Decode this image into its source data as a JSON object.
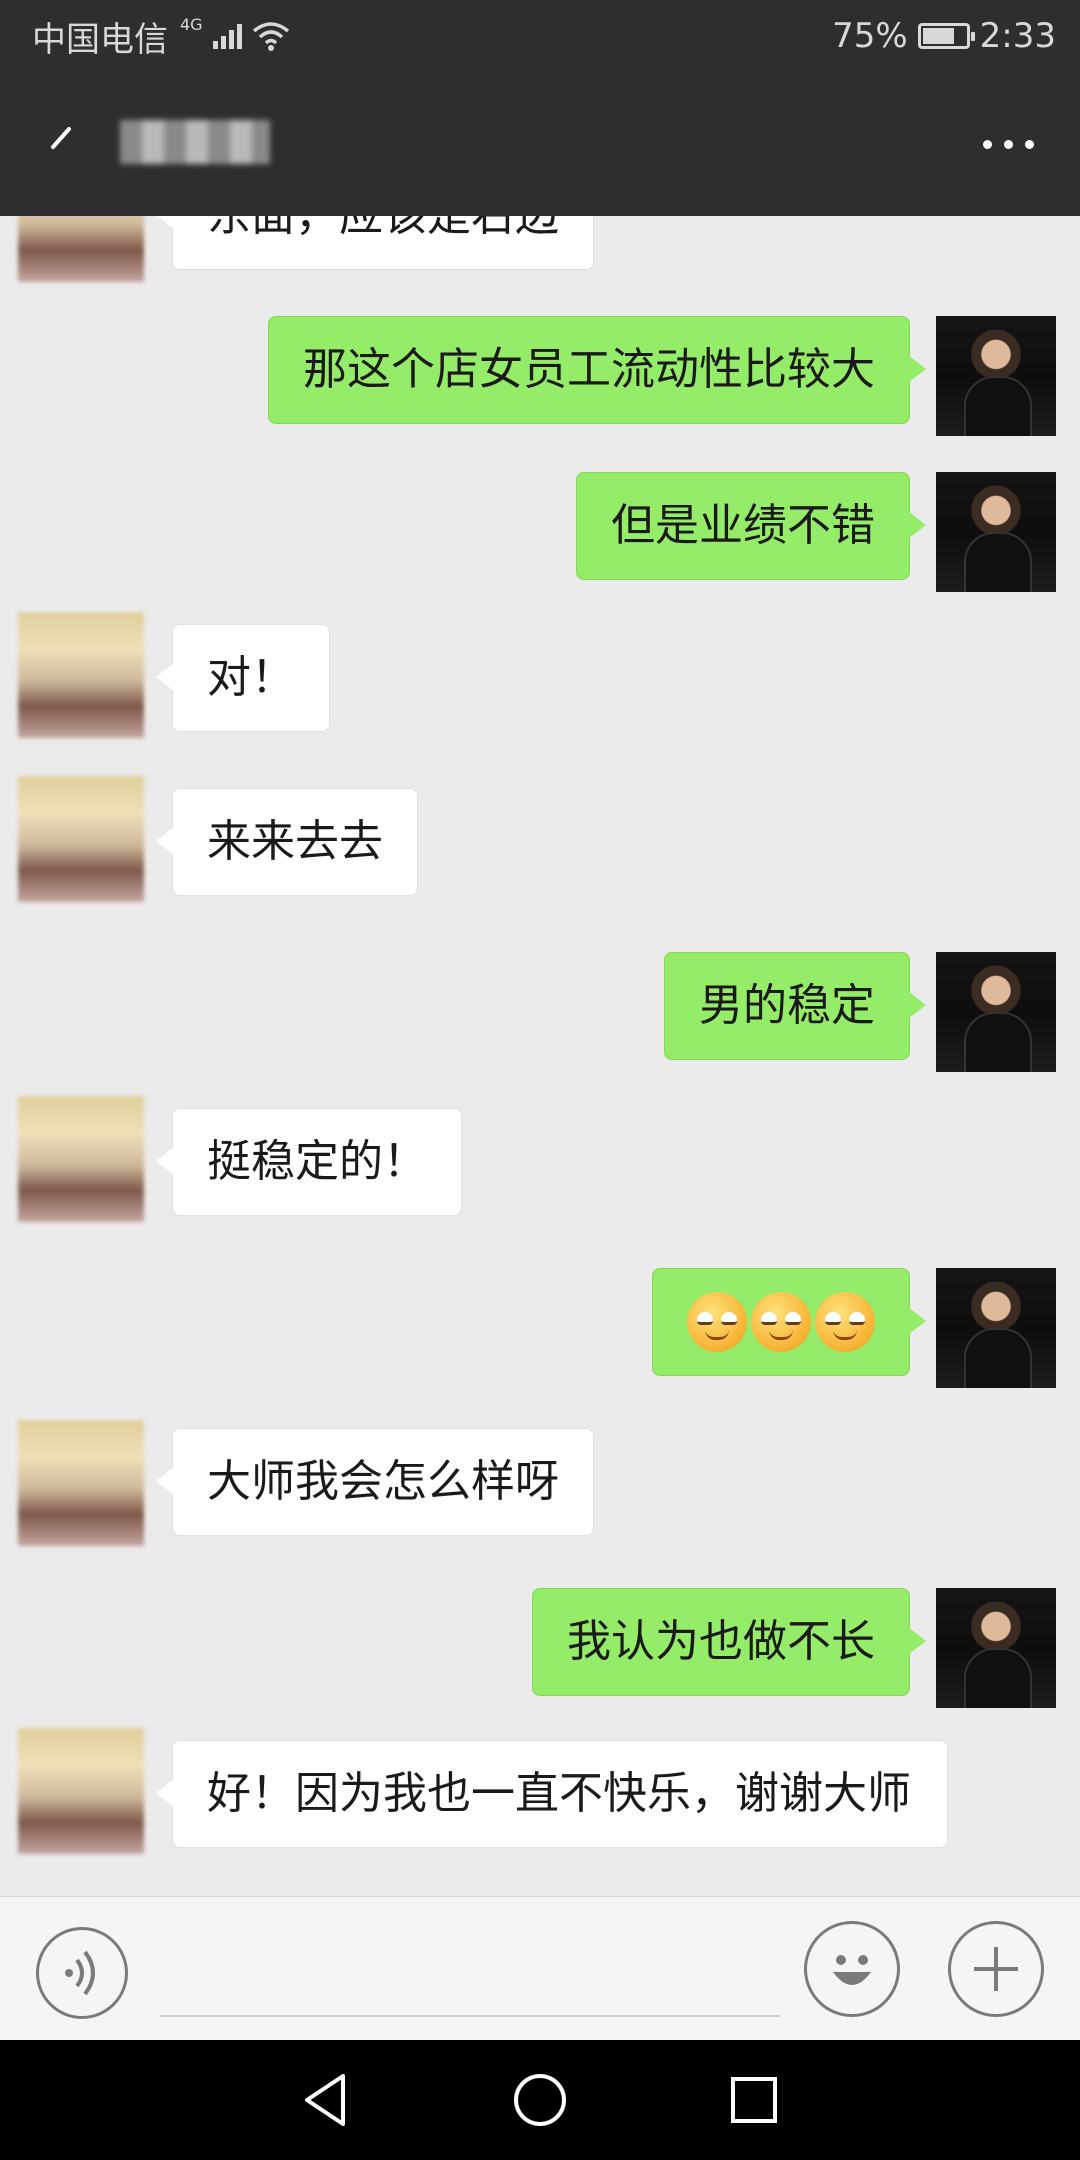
{
  "status_bar": {
    "carrier": "中国电信",
    "network": "4G",
    "battery_percent": "75%",
    "battery_level": 0.75,
    "time": "2:33"
  },
  "header": {
    "back_icon": "back-arrow-icon",
    "more_icon": "more-dots-icon"
  },
  "messages": [
    {
      "side": "left",
      "text": "东面，应该是右边"
    },
    {
      "side": "right",
      "text": "那这个店女员工流动性比较大"
    },
    {
      "side": "right",
      "text": "但是业绩不错"
    },
    {
      "side": "left",
      "text": "对！"
    },
    {
      "side": "left",
      "text": "来来去去"
    },
    {
      "side": "right",
      "text": "男的稳定"
    },
    {
      "side": "left",
      "text": "挺稳定的！"
    },
    {
      "side": "right",
      "emoji_count": 3,
      "emoji": "smirk-face-icon"
    },
    {
      "side": "left",
      "text": "大师我会怎么样呀"
    },
    {
      "side": "right",
      "text": "我认为也做不长"
    },
    {
      "side": "left",
      "text": "好！因为我也一直不快乐，谢谢大师"
    }
  ],
  "input_bar": {
    "voice_icon": "voice-icon",
    "emoji_icon": "emoji-icon",
    "plus_icon": "plus-icon",
    "input_value": ""
  },
  "nav_bar": {
    "back_icon": "nav-back-icon",
    "home_icon": "nav-home-icon",
    "recents_icon": "nav-recents-icon"
  },
  "colors": {
    "header_bg": "#2e2e2e",
    "chat_bg": "#ebebeb",
    "bubble_sent": "#95ec69",
    "bubble_received": "#ffffff"
  }
}
